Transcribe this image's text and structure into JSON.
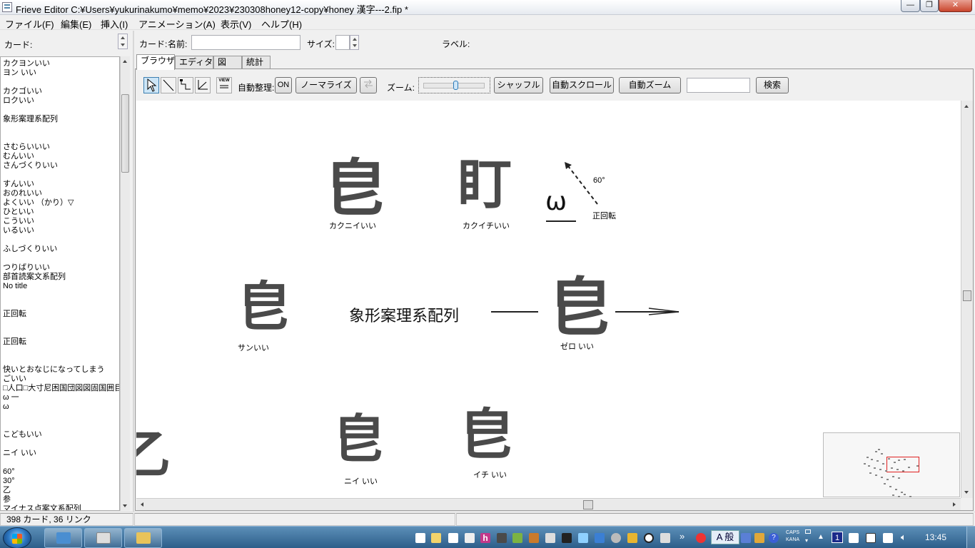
{
  "window": {
    "title": "Frieve Editor C:¥Users¥yukurinakumo¥memo¥2023¥230308honey12-copy¥honey 漢字---2.fip *",
    "min": "—",
    "max": "❐",
    "close": "✕"
  },
  "menu": [
    "ファイル(F)",
    "編集(E)",
    "挿入(I)",
    "アニメーション(A)",
    "表示(V)",
    "ヘルプ(H)"
  ],
  "left": {
    "label": "カード:",
    "items": [
      "  カクヨンいい",
      "    ヨン いい",
      "",
      "   カクゴいい",
      "     ロクいい",
      "",
      "象形案理系配列",
      "",
      "",
      "さむらいいい",
      "むんいい",
      "さんづくりいい",
      "",
      "すんいい",
      "おのれいい",
      "よくいい （かり）▽",
      "ひといい",
      "こういい",
      "いるいい",
      "",
      "ふしづくりいい",
      "",
      "つりばりいい",
      "部首読案文系配列",
      "No title",
      "",
      "",
      "正回転",
      "",
      "",
      "正回転",
      "",
      "",
      "快いとおなじになってしまう",
      "ごいい",
      "□人口□大寸尼困国団図図固国囲目",
      "ω 一",
      "ω",
      "",
      "",
      "こどもいい",
      "",
      "     ニイ いい",
      "",
      "60°",
      "30°",
      "乙",
      "参",
      "マイナス点案文系配列"
    ]
  },
  "cardbar": {
    "card_label": "カード:",
    "name_label": "名前:",
    "name_value": "",
    "size_label": "サイズ:",
    "size_value": "",
    "label_label": "ラベル:"
  },
  "tabs": [
    "ブラウザ",
    "エディタ",
    "図",
    "統計"
  ],
  "toolbar": {
    "view_label": "VIEW",
    "auto_arrange_label": "自動整理:",
    "on_label": "ON",
    "normalize_label": "ノーマライズ",
    "zoom_label": "ズーム:",
    "zoom_level": 0.55,
    "shuffle_label": "シャッフル",
    "auto_scroll_label": "自動スクロール",
    "auto_zoom_label": "自動ズーム",
    "search_value": "",
    "search_label": "検索"
  },
  "canvas": {
    "cards": [
      {
        "glyph": "皀",
        "caption": "カクニイいい"
      },
      {
        "glyph": "盯",
        "caption": "カクイチいい"
      },
      {
        "glyph": "ω",
        "caption": ""
      },
      {
        "glyph": "皀",
        "caption": "サンいい"
      },
      {
        "glyph": "皀",
        "caption": "ゼロ いい"
      },
      {
        "glyph": "皀",
        "caption": "ニイ いい"
      },
      {
        "glyph": "皀",
        "caption": "イチ いい"
      }
    ],
    "angle_label": "60°",
    "rotation_label": "正回転",
    "center_title": "象形案理系配列"
  },
  "status": {
    "counts": "398 カード, 36 リンク"
  },
  "taskbar": {
    "time": "13:45",
    "caps": "CAPS",
    "kana": "KANA",
    "ime": "A 般",
    "lang_number": "1"
  }
}
